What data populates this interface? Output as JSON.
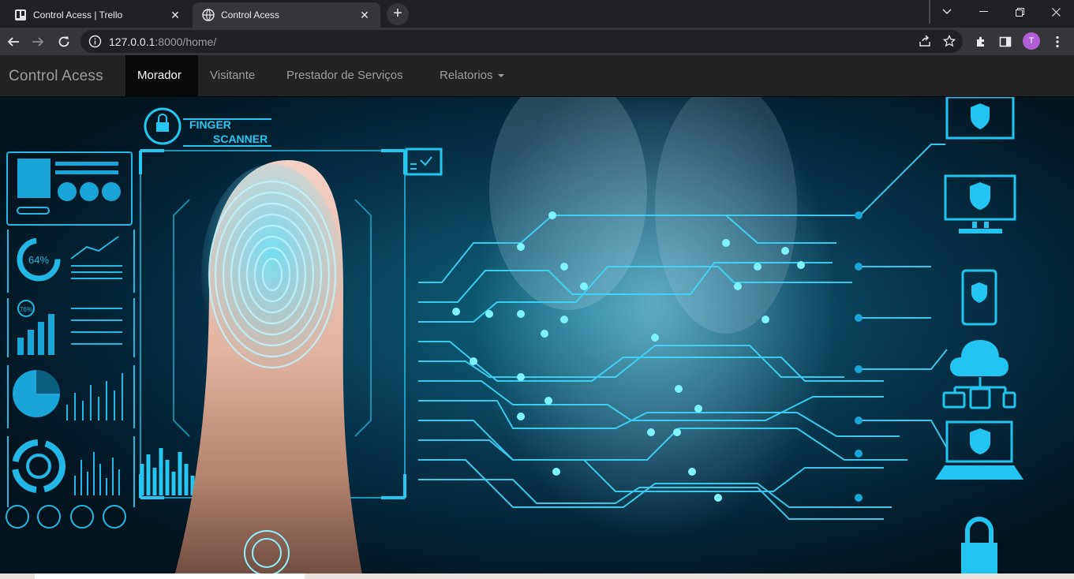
{
  "browser": {
    "tabs": [
      {
        "title": "Control Acess | Trello",
        "active": false,
        "icon": "trello-icon"
      },
      {
        "title": "Control Acess",
        "active": true,
        "icon": "globe-icon"
      }
    ],
    "new_tab": "+",
    "url_host": "127.0.0.1",
    "url_rest": ":8000/home/",
    "profile_initial": "T"
  },
  "site": {
    "brand": "Control Acess",
    "nav": [
      {
        "label": "Morador",
        "active": true
      },
      {
        "label": "Visitante",
        "active": false
      },
      {
        "label": "Prestador de Serviços",
        "active": false
      },
      {
        "label": "Relatorios",
        "active": false,
        "dropdown": true
      }
    ]
  },
  "hero": {
    "scanner_label_1": "FINGER",
    "scanner_label_2": "SCANNER",
    "gauge_percent": "64%",
    "gauge_small": "76%",
    "accent": "#20c8f0"
  }
}
